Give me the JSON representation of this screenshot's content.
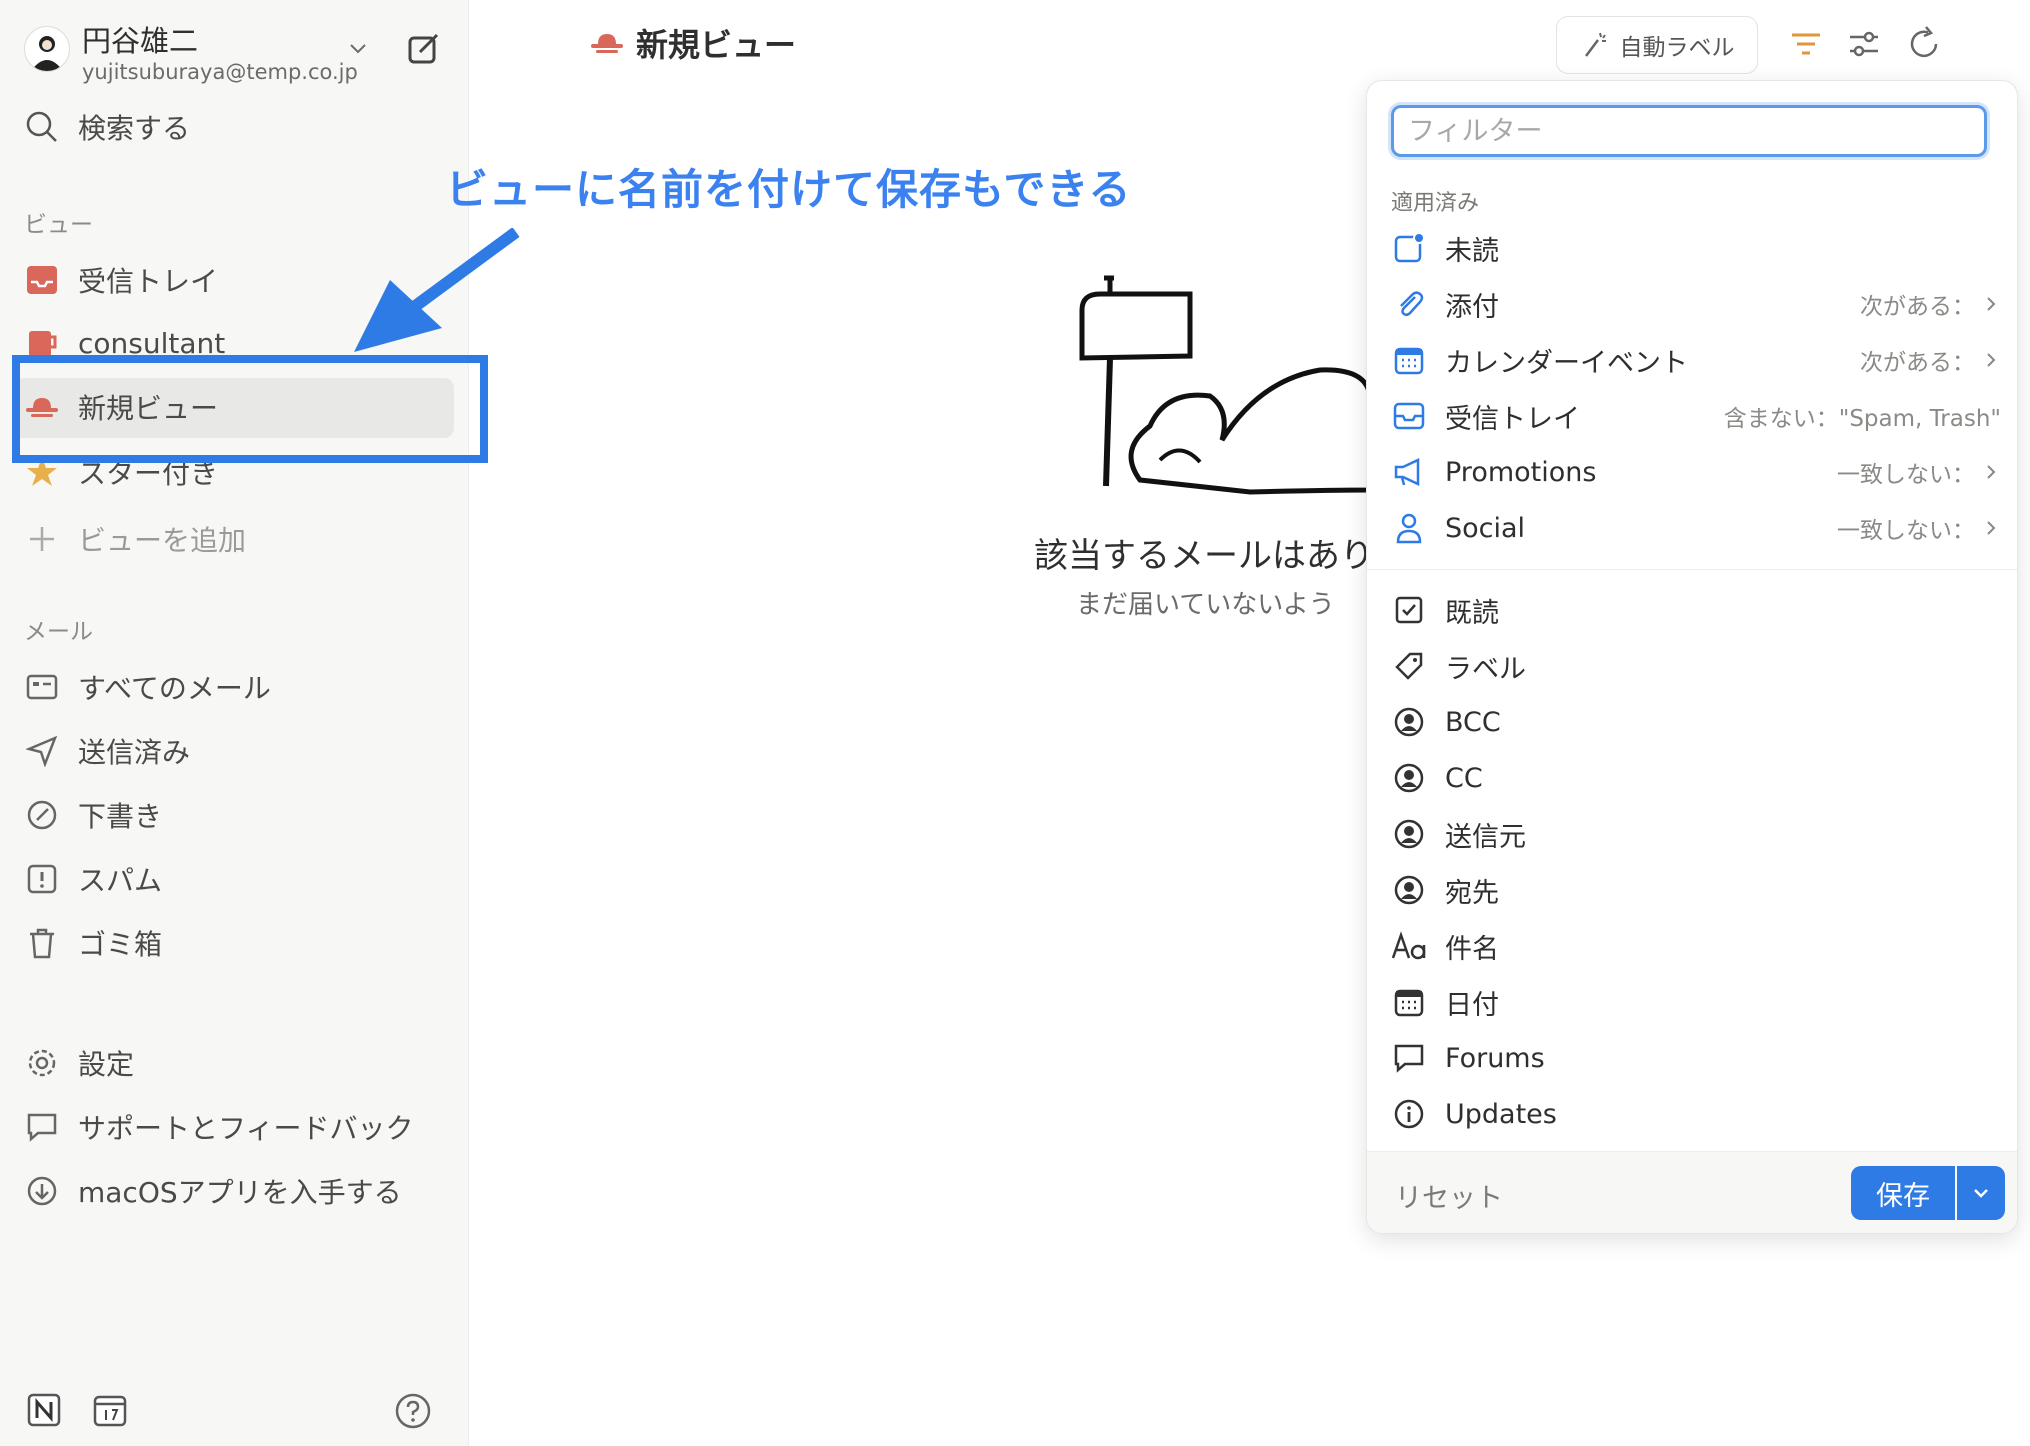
{
  "account": {
    "name": "円谷雄二",
    "email": "yujitsuburaya@temp.co.jp"
  },
  "search": {
    "label": "検索する"
  },
  "sidebar": {
    "views_heading": "ビュー",
    "views": [
      {
        "label": "受信トレイ",
        "icon": "inbox-tray-icon"
      },
      {
        "label": "consultant",
        "icon": "mug-icon"
      },
      {
        "label": "新規ビュー",
        "icon": "hat-icon",
        "selected": true
      },
      {
        "label": "スター付き",
        "icon": "star-icon"
      }
    ],
    "add_view": "ビューを追加",
    "mail_heading": "メール",
    "mail": [
      {
        "label": "すべてのメール",
        "icon": "all-mail-icon"
      },
      {
        "label": "送信済み",
        "icon": "paper-plane-icon"
      },
      {
        "label": "下書き",
        "icon": "draft-pen-icon"
      },
      {
        "label": "スパム",
        "icon": "spam-alert-icon"
      },
      {
        "label": "ゴミ箱",
        "icon": "trash-icon"
      }
    ],
    "bottom": [
      {
        "label": "設定",
        "icon": "gear-icon"
      },
      {
        "label": "サポートとフィードバック",
        "icon": "chat-bubble-icon"
      },
      {
        "label": "macOSアプリを入手する",
        "icon": "download-icon"
      }
    ]
  },
  "annotation": "ビューに名前を付けて保存もできる",
  "header": {
    "title": "新規ビュー",
    "auto_label": "自動ラベル"
  },
  "empty": {
    "title": "該当するメールはあり",
    "subtitle": "まだ届いていないよう"
  },
  "filter_panel": {
    "placeholder": "フィルター",
    "applied_heading": "適用済み",
    "applied": [
      {
        "label": "未読",
        "value": "",
        "icon": "unread-icon",
        "chevron": false
      },
      {
        "label": "添付",
        "value": "次がある：",
        "icon": "paperclip-icon",
        "chevron": true
      },
      {
        "label": "カレンダーイベント",
        "value": "次がある：",
        "icon": "calendar-icon",
        "chevron": true
      },
      {
        "label": "受信トレイ",
        "value": "含まない：\"Spam, Trash\"",
        "icon": "inbox-icon",
        "chevron": false
      },
      {
        "label": "Promotions",
        "value": "一致しない：",
        "icon": "megaphone-icon",
        "chevron": true
      },
      {
        "label": "Social",
        "value": "一致しない：",
        "icon": "person-icon",
        "chevron": true
      }
    ],
    "others": [
      {
        "label": "既読",
        "icon": "checkbox-icon"
      },
      {
        "label": "ラベル",
        "icon": "tag-icon"
      },
      {
        "label": "BCC",
        "icon": "person-circle-icon"
      },
      {
        "label": "CC",
        "icon": "person-circle-icon"
      },
      {
        "label": "送信元",
        "icon": "person-circle-icon"
      },
      {
        "label": "宛先",
        "icon": "person-circle-icon"
      },
      {
        "label": "件名",
        "icon": "text-aa-icon"
      },
      {
        "label": "日付",
        "icon": "calendar-grid-icon"
      },
      {
        "label": "Forums",
        "icon": "speech-bubble-icon"
      },
      {
        "label": "Updates",
        "icon": "info-icon"
      }
    ],
    "reset": "リセット",
    "save": "保存"
  },
  "colors": {
    "accent": "#2f7be5",
    "view_icon": "#d9675a",
    "annotation": "#3b82f0"
  }
}
